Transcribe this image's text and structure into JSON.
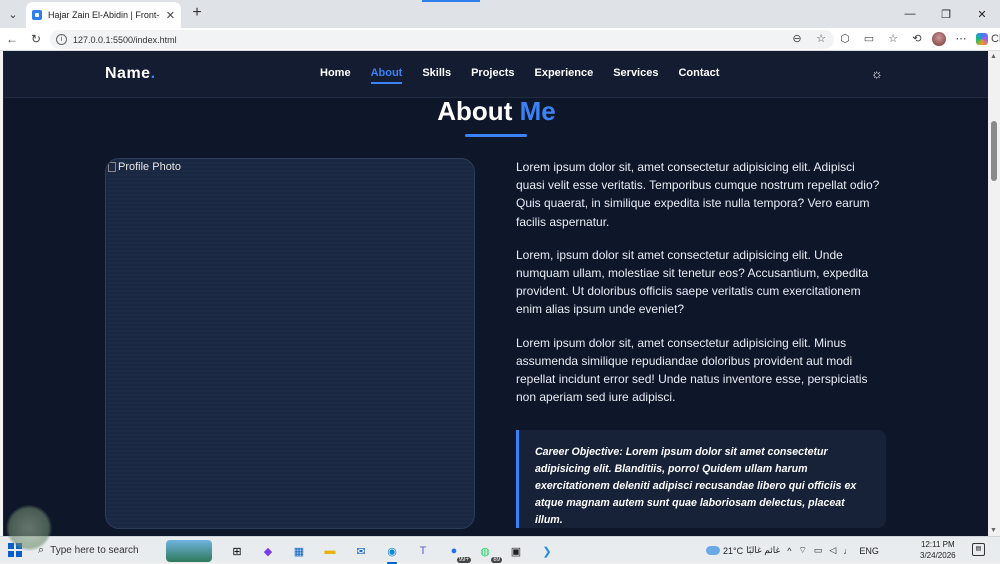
{
  "browser": {
    "tab_title": "Hajar Zain El-Abidin | Front-End De",
    "address": "127.0.0.1:5500/index.html",
    "copilot_label": "Chat"
  },
  "site": {
    "logo": "Name",
    "logo_dot": ".",
    "nav": [
      "Home",
      "About",
      "Skills",
      "Projects",
      "Experience",
      "Services",
      "Contact"
    ],
    "active_nav": "About",
    "about_title_main": "About",
    "about_title_accent": "Me",
    "photo_alt": "Profile Photo",
    "paragraphs": [
      "Lorem ipsum dolor sit, amet consectetur adipisicing elit. Adipisci quasi velit esse veritatis. Temporibus cumque nostrum repellat odio? Quis quaerat, in similique expedita iste nulla tempora? Vero earum facilis aspernatur.",
      "Lorem, ipsum dolor sit amet consectetur adipisicing elit. Unde numquam ullam, molestiae sit tenetur eos? Accusantium, expedita provident. Ut doloribus officiis saepe veritatis cum exercitationem enim alias ipsum unde eveniet?",
      "Lorem ipsum dolor sit, amet consectetur adipisicing elit. Minus assumenda similique repudiandae doloribus provident aut modi repellat incidunt error sed! Unde natus inventore esse, perspiciatis non aperiam sed iure adipisci."
    ],
    "career_label": "Career Objective:",
    "career_text": " Lorem ipsum dolor sit amet consectetur adipisicing elit. Blanditiis, porro! Quidem ullam harum exercitationem deleniti adipisci recusandae libero qui officiis ex atque magnam autem sunt quae laboriosam delectus, placeat illum.",
    "accent_color": "#3b82f6"
  },
  "taskbar": {
    "search_placeholder": "Type here to search",
    "badge_teams": "99+",
    "badge_whatsapp": "89",
    "weather": "21°C",
    "weather_desc": "غائم غالبًا",
    "lang": "ENG",
    "time": "12:11 PM",
    "date": "3/24/2026"
  }
}
